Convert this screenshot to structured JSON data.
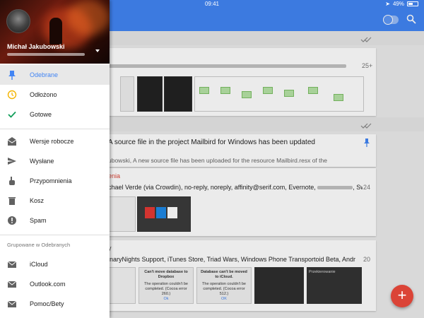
{
  "status_bar": {
    "time": "09:41",
    "battery": "49%"
  },
  "drawer": {
    "account": {
      "name": "Michał Jakubowski"
    },
    "items": [
      {
        "label": "Odebrane",
        "icon": "pin-icon",
        "active": true
      },
      {
        "label": "Odłożono",
        "icon": "clock-icon"
      },
      {
        "label": "Gotowe",
        "icon": "check-icon"
      },
      {
        "label": "Wersje robocze",
        "icon": "drafts-icon"
      },
      {
        "label": "Wysłane",
        "icon": "send-icon"
      },
      {
        "label": "Przypomnienia",
        "icon": "reminder-hand-icon"
      },
      {
        "label": "Kosz",
        "icon": "trash-icon"
      },
      {
        "label": "Spam",
        "icon": "spam-icon"
      }
    ],
    "group_header": "Grupowane w Odebranych",
    "groups": [
      {
        "label": "iCloud",
        "icon": "mail-icon"
      },
      {
        "label": "Outlook.com",
        "icon": "mail-icon"
      },
      {
        "label": "Pomoc/Bety",
        "icon": "mail-icon"
      }
    ]
  },
  "inbox": {
    "bundle1": {
      "count": "25+"
    },
    "mail2": {
      "subject": "A source file in the project Mailbird for Windows has been updated",
      "snippet": "ubowski, A new source file has been uploaded for the resource Mailbird.resx of the"
    },
    "bundle3": {
      "category": "enia",
      "senders": "chael Verde (via Crowdin), no-reply, noreply, affinity@serif.com, Evernote,",
      "senders_tail": ", SwiftK...",
      "count": "24"
    },
    "bundle4": {
      "category": "y",
      "senders": "inaryNights Support, iTunes Store, Triad Wars, Windows Phone Transportoid Beta, Android Beta...",
      "count": "20",
      "thumbs": [
        {
          "title": "Can't move database to Dropbox",
          "body": "The operation couldn't be completed. (Cocoa error 260.)",
          "ok": "Ok"
        },
        {
          "title": "Database can't be moved to iCloud.",
          "body": "The operation couldn't be completed. (Cocoa error 512.)",
          "ok": "OK"
        }
      ],
      "partial_title": "Przekierowanie"
    }
  },
  "fab": {
    "label": "+"
  },
  "colors": {
    "primary": "#4285f4",
    "fab": "#db4437",
    "active_check": "#0f9d58",
    "clock": "#f4b400"
  }
}
